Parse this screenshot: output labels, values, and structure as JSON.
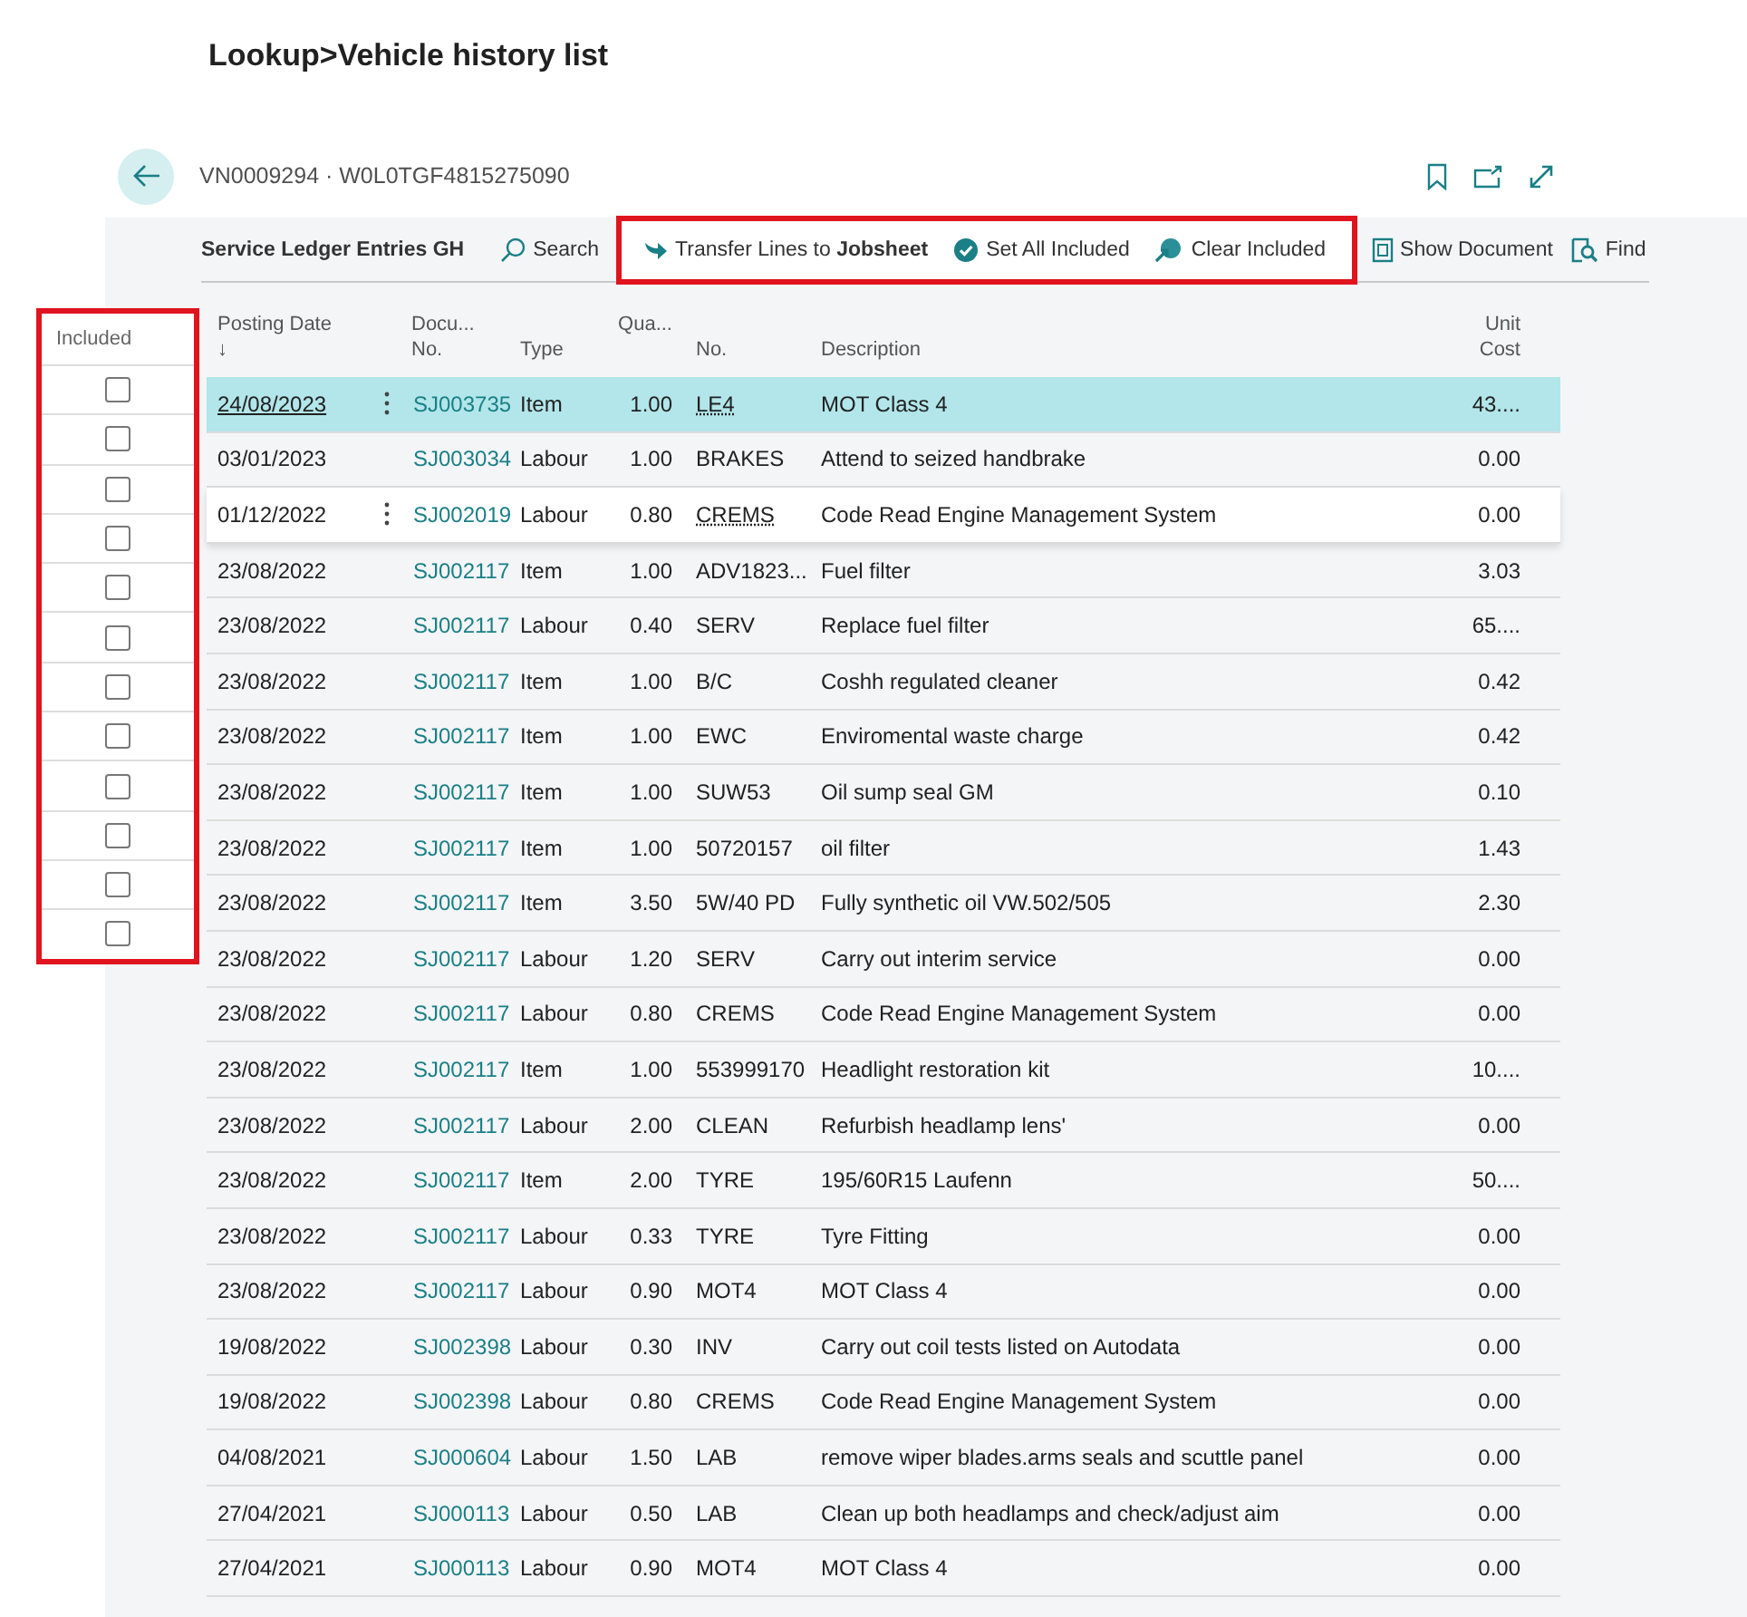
{
  "page_title": "Lookup>Vehicle history list",
  "record": {
    "title": "VN0009294 · W0L0TGF4815275090"
  },
  "toolbar": {
    "page_name": "Service Ledger Entries GH",
    "search": "Search",
    "actions": [
      {
        "label": "Transfer Lines to **Jobsheet**",
        "kind": "transfer",
        "highlighted": true
      },
      {
        "label": "Set All Included",
        "kind": "set_included",
        "highlighted": true
      },
      {
        "label": "Clear Included",
        "kind": "clear_included",
        "highlighted": true
      },
      {
        "label": "Show Document",
        "kind": "document",
        "highlighted": false
      },
      {
        "label": "Find",
        "kind": "find",
        "highlighted": false
      }
    ]
  },
  "included": {
    "header": "Included",
    "rows": [
      {
        "checked": false
      },
      {
        "checked": false
      },
      {
        "checked": false
      },
      {
        "checked": false
      },
      {
        "checked": false
      },
      {
        "checked": false
      },
      {
        "checked": false
      },
      {
        "checked": false
      },
      {
        "checked": false
      },
      {
        "checked": false
      },
      {
        "checked": false
      },
      {
        "checked": false
      }
    ]
  },
  "table": {
    "columns": [
      {
        "label": "Posting Date",
        "sort": "↓"
      },
      {
        "label": "Docu... No."
      },
      {
        "label": "Type"
      },
      {
        "label": "Qua..."
      },
      {
        "label": "No."
      },
      {
        "label": "Description"
      },
      {
        "label": "Unit Cost"
      }
    ],
    "rows": [
      {
        "posting_date": "24/08/2023",
        "document_no": "SJ003735",
        "type": "Item",
        "quantity": "1.00",
        "no": "LE4",
        "description": "MOT Class 4",
        "unit_cost": "43....",
        "selected": true,
        "hovered": false
      },
      {
        "posting_date": "03/01/2023",
        "document_no": "SJ003034",
        "type": "Labour",
        "quantity": "1.00",
        "no": "BRAKES",
        "description": "Attend to seized handbrake",
        "unit_cost": "0.00",
        "selected": false,
        "hovered": false
      },
      {
        "posting_date": "01/12/2022",
        "document_no": "SJ002019",
        "type": "Labour",
        "quantity": "0.80",
        "no": "CREMS",
        "description": "Code Read Engine Management System",
        "unit_cost": "0.00",
        "selected": false,
        "hovered": true
      },
      {
        "posting_date": "23/08/2022",
        "document_no": "SJ002117",
        "type": "Item",
        "quantity": "1.00",
        "no": "ADV1823...",
        "description": "Fuel filter",
        "unit_cost": "3.03",
        "selected": false,
        "hovered": false
      },
      {
        "posting_date": "23/08/2022",
        "document_no": "SJ002117",
        "type": "Labour",
        "quantity": "0.40",
        "no": "SERV",
        "description": "Replace fuel filter",
        "unit_cost": "65....",
        "selected": false,
        "hovered": false
      },
      {
        "posting_date": "23/08/2022",
        "document_no": "SJ002117",
        "type": "Item",
        "quantity": "1.00",
        "no": "B/C",
        "description": "Coshh regulated cleaner",
        "unit_cost": "0.42",
        "selected": false,
        "hovered": false
      },
      {
        "posting_date": "23/08/2022",
        "document_no": "SJ002117",
        "type": "Item",
        "quantity": "1.00",
        "no": "EWC",
        "description": "Enviromental waste charge",
        "unit_cost": "0.42",
        "selected": false,
        "hovered": false
      },
      {
        "posting_date": "23/08/2022",
        "document_no": "SJ002117",
        "type": "Item",
        "quantity": "1.00",
        "no": "SUW53",
        "description": "Oil sump seal GM",
        "unit_cost": "0.10",
        "selected": false,
        "hovered": false
      },
      {
        "posting_date": "23/08/2022",
        "document_no": "SJ002117",
        "type": "Item",
        "quantity": "1.00",
        "no": "50720157",
        "description": "oil filter",
        "unit_cost": "1.43",
        "selected": false,
        "hovered": false
      },
      {
        "posting_date": "23/08/2022",
        "document_no": "SJ002117",
        "type": "Item",
        "quantity": "3.50",
        "no": "5W/40 PD",
        "description": "Fully synthetic oil VW.502/505",
        "unit_cost": "2.30",
        "selected": false,
        "hovered": false
      },
      {
        "posting_date": "23/08/2022",
        "document_no": "SJ002117",
        "type": "Labour",
        "quantity": "1.20",
        "no": "SERV",
        "description": "Carry out interim service",
        "unit_cost": "0.00",
        "selected": false,
        "hovered": false
      },
      {
        "posting_date": "23/08/2022",
        "document_no": "SJ002117",
        "type": "Labour",
        "quantity": "0.80",
        "no": "CREMS",
        "description": "Code Read Engine Management System",
        "unit_cost": "0.00",
        "selected": false,
        "hovered": false
      },
      {
        "posting_date": "23/08/2022",
        "document_no": "SJ002117",
        "type": "Item",
        "quantity": "1.00",
        "no": "553999170",
        "description": "Headlight restoration kit",
        "unit_cost": "10....",
        "selected": false,
        "hovered": false
      },
      {
        "posting_date": "23/08/2022",
        "document_no": "SJ002117",
        "type": "Labour",
        "quantity": "2.00",
        "no": "CLEAN",
        "description": "Refurbish headlamp lens'",
        "unit_cost": "0.00",
        "selected": false,
        "hovered": false
      },
      {
        "posting_date": "23/08/2022",
        "document_no": "SJ002117",
        "type": "Item",
        "quantity": "2.00",
        "no": "TYRE",
        "description": "195/60R15 Laufenn",
        "unit_cost": "50....",
        "selected": false,
        "hovered": false
      },
      {
        "posting_date": "23/08/2022",
        "document_no": "SJ002117",
        "type": "Labour",
        "quantity": "0.33",
        "no": "TYRE",
        "description": "Tyre Fitting",
        "unit_cost": "0.00",
        "selected": false,
        "hovered": false
      },
      {
        "posting_date": "23/08/2022",
        "document_no": "SJ002117",
        "type": "Labour",
        "quantity": "0.90",
        "no": "MOT4",
        "description": "MOT Class 4",
        "unit_cost": "0.00",
        "selected": false,
        "hovered": false
      },
      {
        "posting_date": "19/08/2022",
        "document_no": "SJ002398",
        "type": "Labour",
        "quantity": "0.30",
        "no": "INV",
        "description": "Carry out coil tests listed on Autodata",
        "unit_cost": "0.00",
        "selected": false,
        "hovered": false
      },
      {
        "posting_date": "19/08/2022",
        "document_no": "SJ002398",
        "type": "Labour",
        "quantity": "0.80",
        "no": "CREMS",
        "description": "Code Read Engine Management System",
        "unit_cost": "0.00",
        "selected": false,
        "hovered": false
      },
      {
        "posting_date": "04/08/2021",
        "document_no": "SJ000604",
        "type": "Labour",
        "quantity": "1.50",
        "no": "LAB",
        "description": "remove wiper blades.arms seals and scuttle panel",
        "unit_cost": "0.00",
        "selected": false,
        "hovered": false
      },
      {
        "posting_date": "27/04/2021",
        "document_no": "SJ000113",
        "type": "Labour",
        "quantity": "0.50",
        "no": "LAB",
        "description": "Clean up both headlamps and check/adjust aim",
        "unit_cost": "0.00",
        "selected": false,
        "hovered": false
      },
      {
        "posting_date": "27/04/2021",
        "document_no": "SJ000113",
        "type": "Labour",
        "quantity": "0.90",
        "no": "MOT4",
        "description": "MOT Class 4",
        "unit_cost": "0.00",
        "selected": false,
        "hovered": false
      }
    ]
  }
}
